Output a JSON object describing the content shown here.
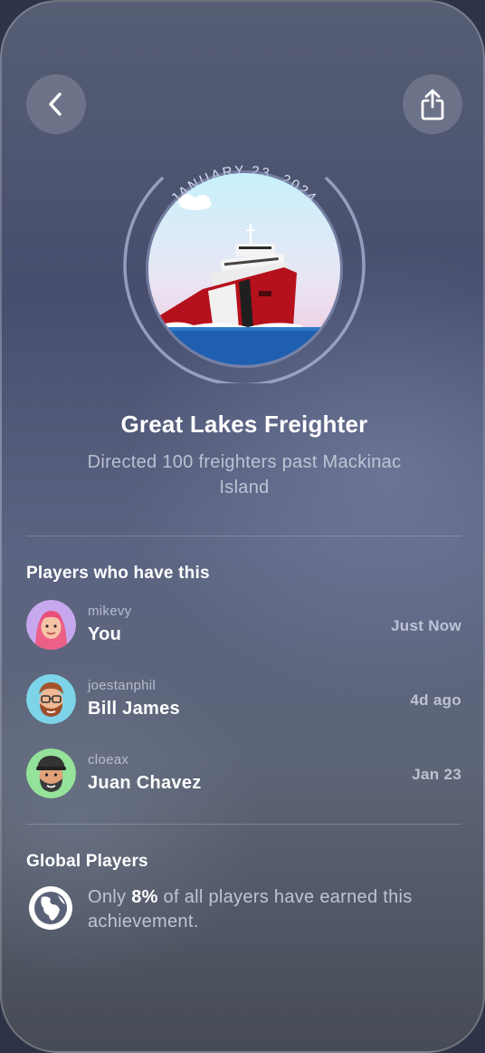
{
  "nav": {
    "back_icon": "chevron-left-icon",
    "share_icon": "share-icon"
  },
  "achievement": {
    "date": "JANUARY 23, 2024",
    "title": "Great Lakes Freighter",
    "description": "Directed 100 freighters past Mackinac Island",
    "badge_icon": "freighter-ship-badge"
  },
  "players_section": {
    "title": "Players who have this",
    "players": [
      {
        "handle": "mikevy",
        "name": "You",
        "time": "Just Now",
        "avatar": "pink-hair-memoji-avatar"
      },
      {
        "handle": "joestanphil",
        "name": "Bill James",
        "time": "4d ago",
        "avatar": "glasses-beard-memoji-avatar"
      },
      {
        "handle": "cloeax",
        "name": "Juan Chavez",
        "time": "Jan 23",
        "avatar": "cap-beard-memoji-avatar"
      }
    ]
  },
  "global_section": {
    "title": "Global Players",
    "text_prefix": "Only ",
    "percent": "8%",
    "text_suffix": " of all players have earned this achievement.",
    "icon": "globe-icon"
  },
  "colors": {
    "sea": "#1f5fb0",
    "hull": "#b5111c",
    "sky": "#cfeff7"
  }
}
